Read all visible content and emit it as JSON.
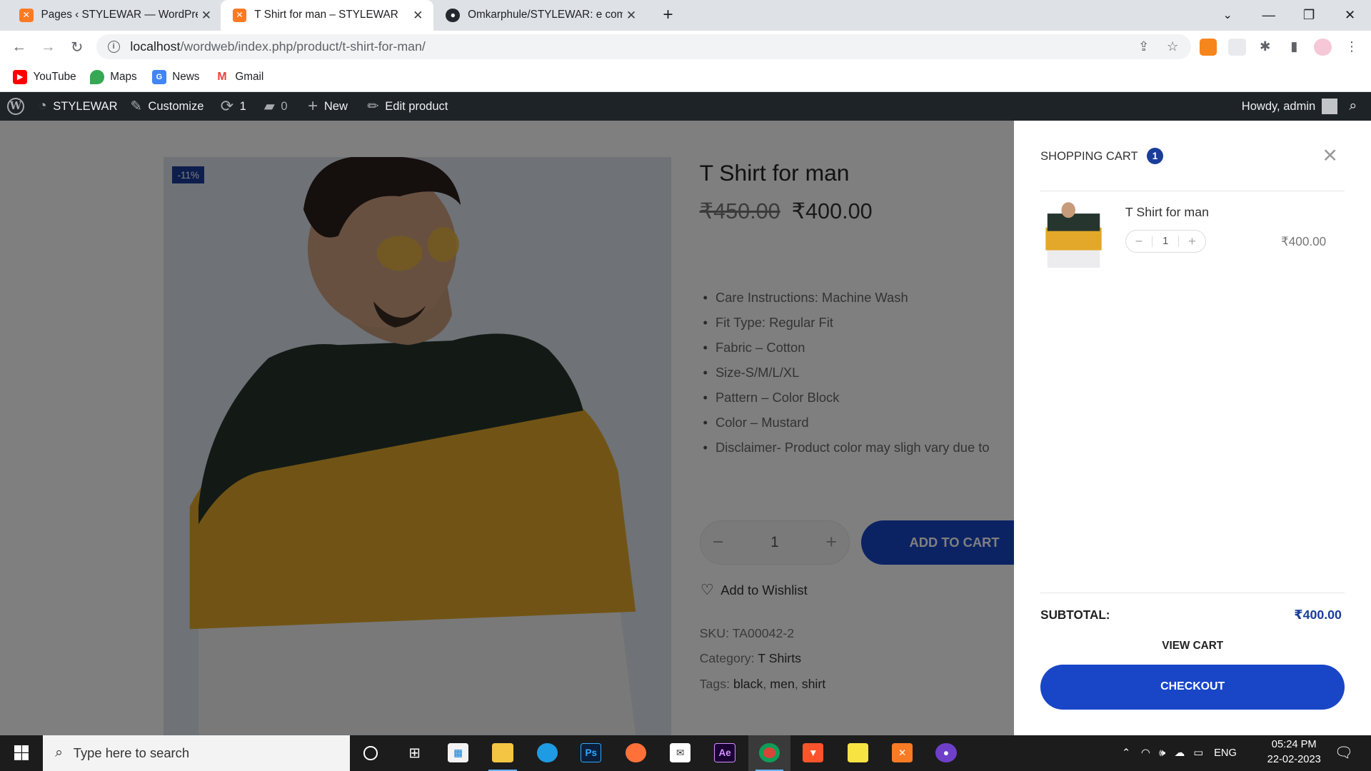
{
  "browser": {
    "tabs": [
      {
        "title": "Pages ‹ STYLEWAR — WordPress",
        "icon": "xampp-icon"
      },
      {
        "title": "T Shirt for man – STYLEWAR",
        "icon": "xampp-icon"
      },
      {
        "title": "Omkarphule/STYLEWAR: e comm",
        "icon": "github-icon"
      }
    ],
    "url_host": "localhost",
    "url_path": "/wordweb/index.php/product/t-shirt-for-man/"
  },
  "bookmarks": [
    "YouTube",
    "Maps",
    "News",
    "Gmail"
  ],
  "adminbar": {
    "site": "STYLEWAR",
    "customize": "Customize",
    "updates": "1",
    "comments": "0",
    "new": "New",
    "edit": "Edit product",
    "howdy": "Howdy, admin"
  },
  "product": {
    "badge": "-11%",
    "title": "T Shirt for man",
    "old_price": "₹450.00",
    "price": "₹400.00",
    "features": [
      "Care Instructions: Machine Wash",
      "Fit Type: Regular Fit",
      "Fabric – Cotton",
      "Size-S/M/L/XL",
      "Pattern – Color Block",
      "Color – Mustard",
      "Disclaimer- Product color may sligh vary due to"
    ],
    "qty": "1",
    "add_to_cart": "ADD TO CART",
    "wishlist": "Add to Wishlist",
    "sku_label": "SKU:",
    "sku": "TA00042-2",
    "category_label": "Category:",
    "category": "T Shirts",
    "tags_label": "Tags:",
    "tags": [
      "black",
      "men",
      "shirt"
    ]
  },
  "cart": {
    "heading": "SHOPPING CART",
    "count": "1",
    "item_name": "T Shirt for man",
    "item_qty": "1",
    "item_price": "₹400.00",
    "subtotal_label": "SUBTOTAL:",
    "subtotal": "₹400.00",
    "view_cart": "VIEW CART",
    "checkout": "CHECKOUT"
  },
  "taskbar": {
    "search_placeholder": "Type here to search",
    "lang": "ENG",
    "time": "05:24 PM",
    "date": "22-02-2023"
  },
  "colors": {
    "accent": "#1846c7",
    "badge": "#1a3d9a",
    "adminbar": "#1d2327"
  }
}
